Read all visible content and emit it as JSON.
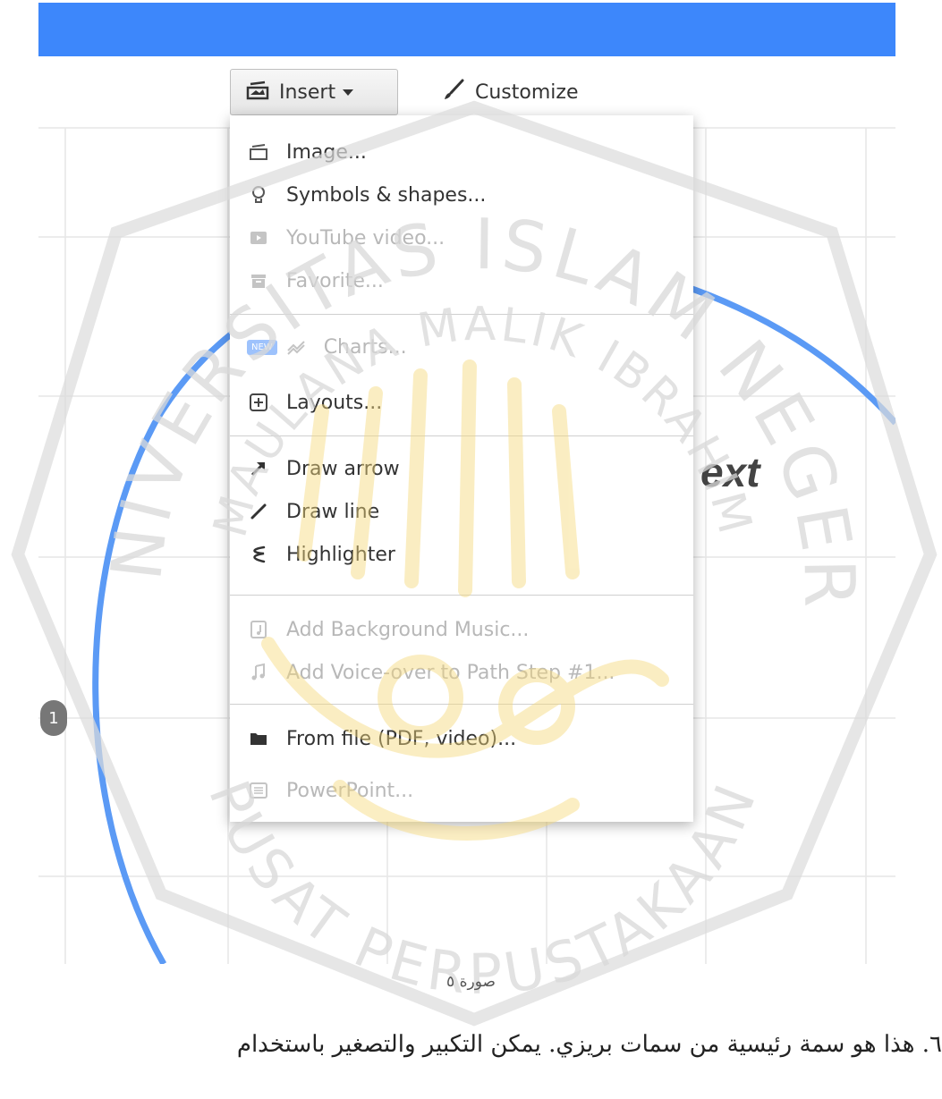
{
  "toolbar": {
    "insert_label": "Insert",
    "customize_label": "Customize"
  },
  "menu": {
    "items": [
      {
        "label": "Image...",
        "icon": "image-icon",
        "enabled": true
      },
      {
        "label": "Symbols & shapes...",
        "icon": "lightbulb-icon",
        "enabled": true
      },
      {
        "label": "YouTube video...",
        "icon": "youtube-icon",
        "enabled": false
      },
      {
        "label": "Favorite...",
        "icon": "archive-icon",
        "enabled": false
      },
      {
        "label": "Charts...",
        "icon": "chart-icon",
        "enabled": false,
        "badge": "NEW"
      },
      {
        "label": "Layouts...",
        "icon": "plus-square-icon",
        "enabled": true
      },
      {
        "label": "Draw arrow",
        "icon": "arrow-icon",
        "enabled": true
      },
      {
        "label": "Draw line",
        "icon": "line-icon",
        "enabled": true
      },
      {
        "label": "Highlighter",
        "icon": "highlighter-icon",
        "enabled": true
      },
      {
        "label": "Add Background Music...",
        "icon": "music-file-icon",
        "enabled": false
      },
      {
        "label": "Add Voice-over to Path Step #1...",
        "icon": "music-note-icon",
        "enabled": false
      },
      {
        "label": "From file (PDF, video)...",
        "icon": "folder-icon",
        "enabled": true
      },
      {
        "label": "PowerPoint...",
        "icon": "powerpoint-icon",
        "enabled": false
      }
    ]
  },
  "canvas": {
    "text_fragment": "ext",
    "path_step_number": "1"
  },
  "colors": {
    "topbar": "#3d87fb",
    "circle": "#5b9af5",
    "watermark_text": "#d9d9d9",
    "watermark_calligraphy": "#fbe8a6"
  },
  "watermark": {
    "arc_top": "UNIVERSITAS ISLAM NEGERI",
    "arc_middle": "MAULANA MALIK IBRAHIM",
    "arc_bottom": "PUSAT PERPUSTAKAAN"
  },
  "caption": "صورة ٥",
  "paragraph": "٦. هذا هو سمة رئيسية من سمات بريزي. يمكن التكبير والتصغير باستخدام"
}
